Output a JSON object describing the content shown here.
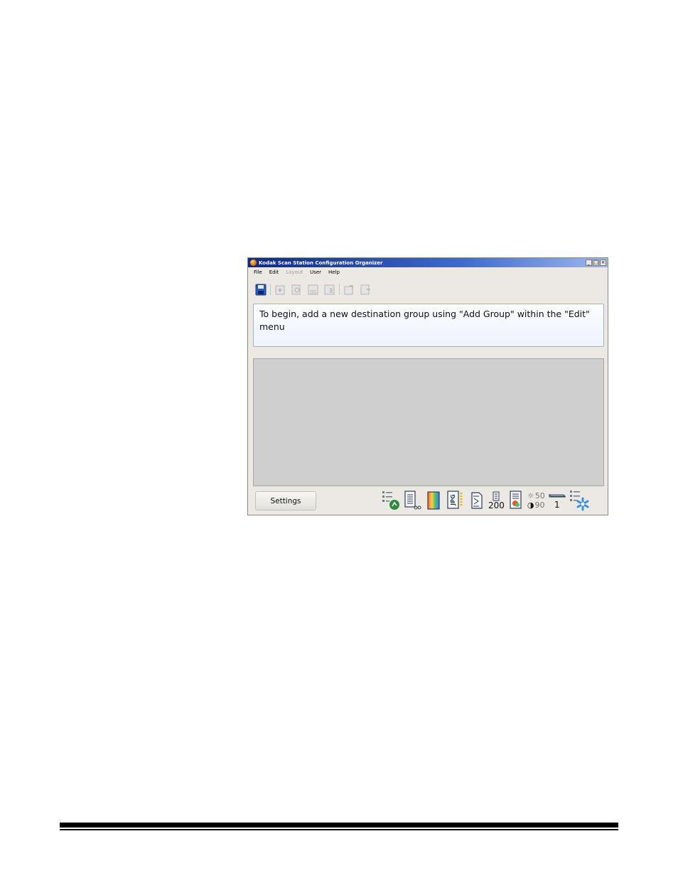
{
  "window": {
    "title": "Kodak Scan Station Configuration Organizer",
    "controls": {
      "minimize": "_",
      "maximize": "□",
      "close": "×"
    }
  },
  "menu": {
    "file": "File",
    "edit": "Edit",
    "layout": "Layout",
    "user": "User",
    "help": "Help"
  },
  "toolbar": {
    "buttons": [
      "save-icon",
      "add-group-icon",
      "find-icon",
      "list-icon",
      "delete-icon",
      "export-icon",
      "import-icon"
    ]
  },
  "info": {
    "message": "To begin, add a new destination group using \"Add Group\" within the \"Edit\" menu"
  },
  "settings": {
    "label": "Settings"
  },
  "status": {
    "resolution": "200",
    "brightness": "50",
    "contrast": "90",
    "page_count": "1",
    "file_format": "JPG"
  },
  "colors": {
    "title_bar_start": "#0a2a8c",
    "work_area": "#cfcfcf",
    "window_bg": "#ece9e4"
  }
}
